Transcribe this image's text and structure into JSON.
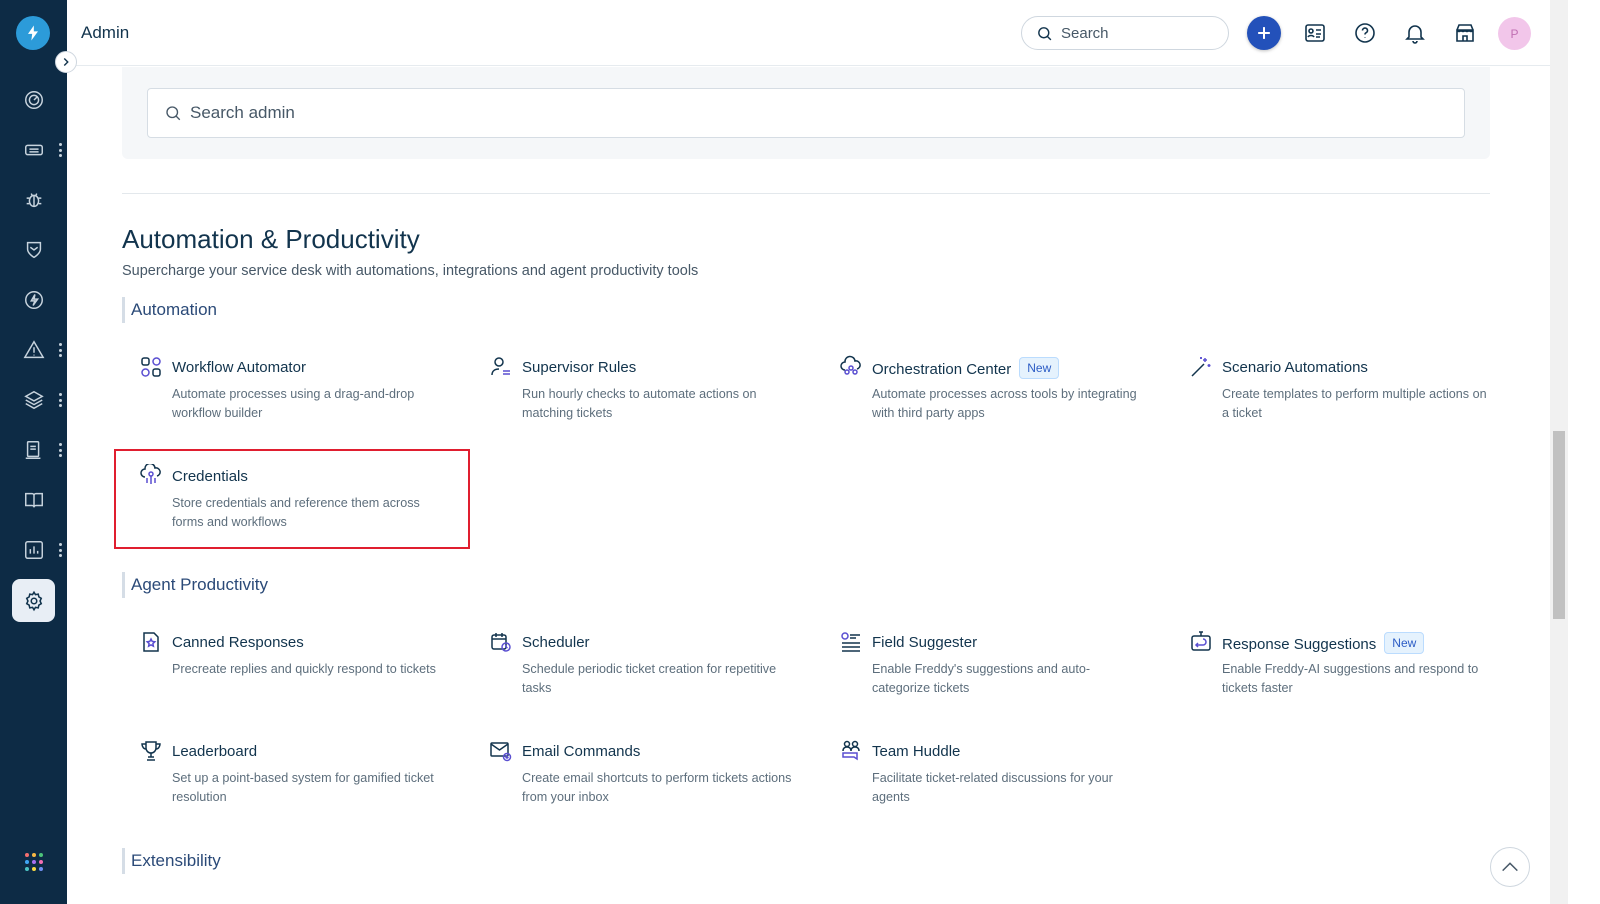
{
  "header": {
    "title": "Admin",
    "search_placeholder": "Search",
    "avatar_initial": "P"
  },
  "admin_search": {
    "placeholder": "Search admin"
  },
  "section": {
    "title": "Automation & Productivity",
    "subtitle": "Supercharge your service desk with automations, integrations and agent productivity tools"
  },
  "groups": {
    "automation": {
      "label": "Automation",
      "items": [
        {
          "title": "Workflow Automator",
          "desc": "Automate processes using a drag-and-drop workflow builder",
          "icon": "workflow-icon"
        },
        {
          "title": "Supervisor Rules",
          "desc": "Run hourly checks to automate actions on matching tickets",
          "icon": "supervisor-icon"
        },
        {
          "title": "Orchestration Center",
          "badge": "New",
          "desc": "Automate processes across tools by integrating with third party apps",
          "icon": "orchestration-icon"
        },
        {
          "title": "Scenario Automations",
          "desc": "Create templates to perform multiple actions on a ticket",
          "icon": "magic-wand-icon"
        },
        {
          "title": "Credentials",
          "desc": "Store credentials and reference them across forms and workflows",
          "icon": "credentials-icon"
        }
      ]
    },
    "agent_productivity": {
      "label": "Agent Productivity",
      "items": [
        {
          "title": "Canned Responses",
          "desc": "Precreate replies and quickly respond to tickets",
          "icon": "canned-response-icon"
        },
        {
          "title": "Scheduler",
          "desc": "Schedule periodic ticket creation for repetitive tasks",
          "icon": "scheduler-icon"
        },
        {
          "title": "Field Suggester",
          "desc": "Enable Freddy's suggestions and auto-categorize tickets",
          "icon": "field-suggester-icon"
        },
        {
          "title": "Response Suggestions",
          "badge": "New",
          "desc": "Enable Freddy-AI suggestions and respond to tickets faster",
          "icon": "response-suggestions-icon"
        },
        {
          "title": "Leaderboard",
          "desc": "Set up a point-based system for gamified ticket resolution",
          "icon": "trophy-icon"
        },
        {
          "title": "Email Commands",
          "desc": "Create email shortcuts to perform tickets actions from your inbox",
          "icon": "email-commands-icon"
        },
        {
          "title": "Team Huddle",
          "desc": "Facilitate ticket-related discussions for your agents",
          "icon": "team-huddle-icon"
        }
      ]
    },
    "extensibility": {
      "label": "Extensibility"
    }
  },
  "colors": {
    "sidebar_bg": "#0d2b45",
    "primary_blue": "#2351ba",
    "highlight_red": "#e01e2f",
    "icon_purple": "#5a4fd1"
  }
}
